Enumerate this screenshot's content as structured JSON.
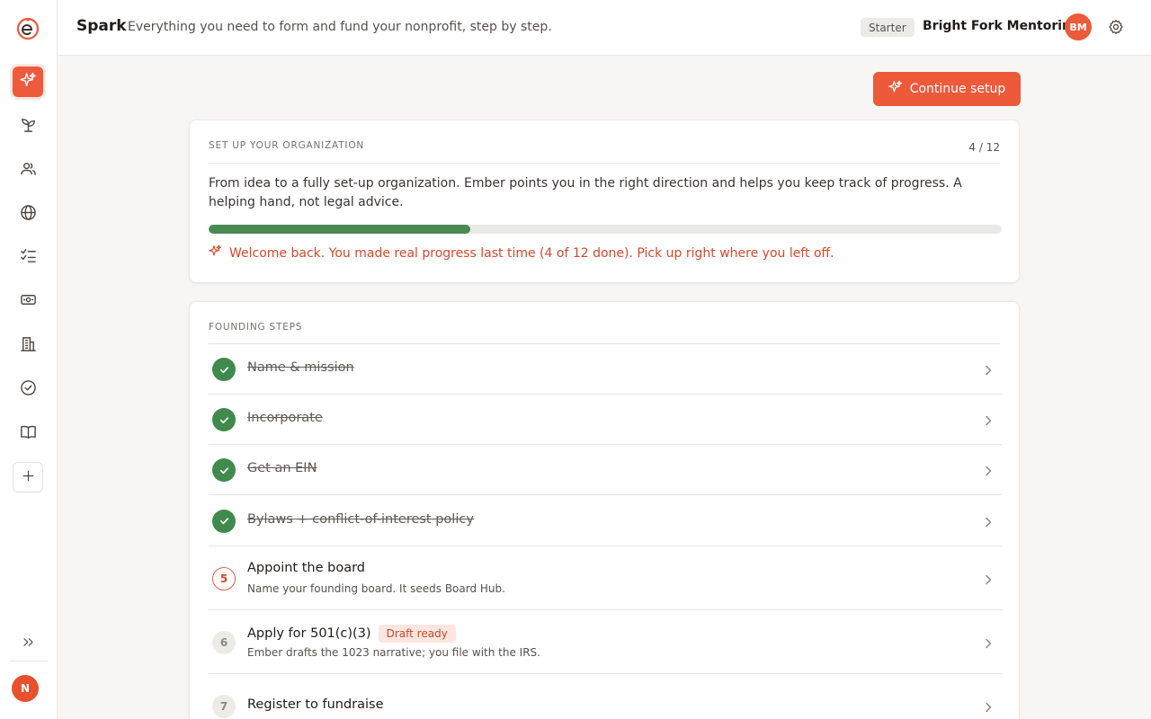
{
  "sidebar": {
    "logo": "ember-logo",
    "items": [
      {
        "name": "sidebar-item-spark",
        "icon": "sparkle-icon",
        "active": true
      },
      {
        "name": "sidebar-item-grow",
        "icon": "sprout-icon",
        "active": false
      },
      {
        "name": "sidebar-item-people",
        "icon": "users-icon",
        "active": false
      },
      {
        "name": "sidebar-item-web",
        "icon": "globe-icon",
        "active": false
      },
      {
        "name": "sidebar-item-tasks",
        "icon": "checklist-icon",
        "active": false
      },
      {
        "name": "sidebar-item-funding",
        "icon": "money-icon",
        "active": false
      },
      {
        "name": "sidebar-item-organization",
        "icon": "building-icon",
        "active": false
      },
      {
        "name": "sidebar-item-compliance",
        "icon": "check-circle-icon",
        "active": false
      },
      {
        "name": "sidebar-item-guides",
        "icon": "book-icon",
        "active": false
      },
      {
        "name": "sidebar-item-add",
        "icon": "plus-icon",
        "active": false
      }
    ],
    "expand_icon": "double-chevron-right-icon",
    "user_initial": "N"
  },
  "header": {
    "app_title": "Spark",
    "tagline": "Everything you need to form and fund your nonprofit, step by step.",
    "plan_badge": "Starter",
    "org_name": "Bright Fork Mentoring",
    "org_initials": "BM",
    "settings_icon": "gear-icon"
  },
  "actions": {
    "continue_label": "Continue setup"
  },
  "overview": {
    "section_label": "SET UP YOUR ORGANIZATION",
    "step_count": "4 / 12",
    "intro": "From idea to a fully set-up organization. Ember points you in the right direction and helps you keep track of progress. A helping hand, not legal advice.",
    "progress": 0.33,
    "welcome": "Welcome back. You made real progress last time (4 of 12 done). Pick up right where you left off."
  },
  "steps": {
    "section_label": "FOUNDING STEPS",
    "items": [
      {
        "number": "1",
        "title": "Name & mission",
        "subtitle": "",
        "status": "done",
        "badge": ""
      },
      {
        "number": "2",
        "title": "Incorporate",
        "subtitle": "",
        "status": "done",
        "badge": ""
      },
      {
        "number": "3",
        "title": "Get an EIN",
        "subtitle": "",
        "status": "done",
        "badge": ""
      },
      {
        "number": "4",
        "title": "Bylaws + conflict-of-interest policy",
        "subtitle": "",
        "status": "done",
        "badge": ""
      },
      {
        "number": "5",
        "title": "Appoint the board",
        "subtitle": "Name your founding board. It seeds Board Hub.",
        "status": "current",
        "badge": ""
      },
      {
        "number": "6",
        "title": "Apply for 501(c)(3)",
        "subtitle": "Ember drafts the 1023 narrative; you file with the IRS.",
        "status": "todo",
        "badge": "Draft ready"
      },
      {
        "number": "7",
        "title": "Register to fundraise",
        "subtitle": "",
        "status": "todo",
        "badge": ""
      }
    ]
  },
  "colors": {
    "accent": "#ec5a3a",
    "done": "#3f8a4c",
    "progress": "#4a8a52"
  }
}
